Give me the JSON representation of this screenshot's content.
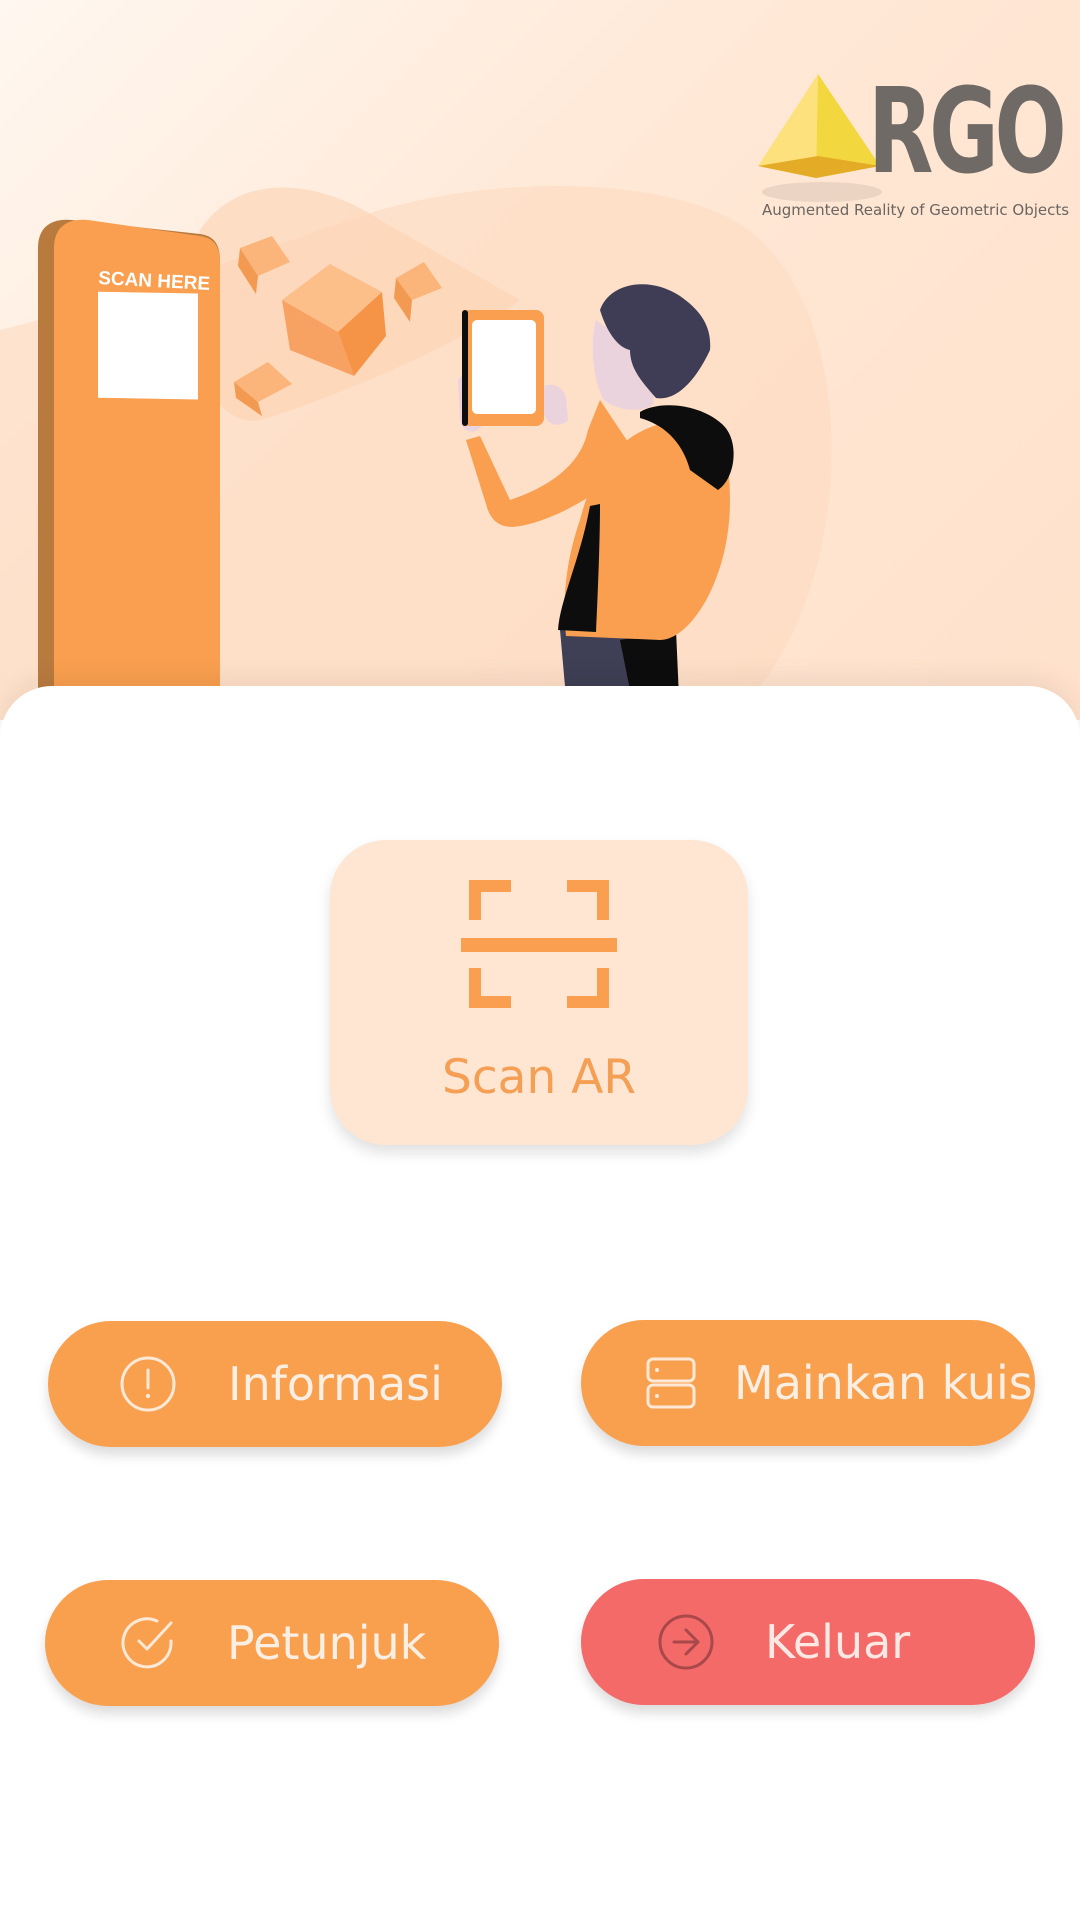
{
  "app": {
    "logo_letters": "RGO",
    "tagline": "Augmented Reality of Geometric Objects"
  },
  "hero": {
    "kiosk_sign": "SCAN HERE"
  },
  "scan": {
    "label": "Scan AR",
    "icon": "scan-frame-icon"
  },
  "menu": [
    {
      "label": "Informasi",
      "icon": "alert-circle-icon"
    },
    {
      "label": "Mainkan kuis",
      "icon": "server-icon"
    },
    {
      "label": "Petunjuk",
      "icon": "check-circle-icon"
    },
    {
      "label": "Keluar",
      "icon": "arrow-right-circle-icon"
    }
  ],
  "colors": {
    "primary": "#f9a04f",
    "scan_card": "#fee6d2",
    "exit": "#f46a68",
    "logo_text": "#6f6a66"
  }
}
